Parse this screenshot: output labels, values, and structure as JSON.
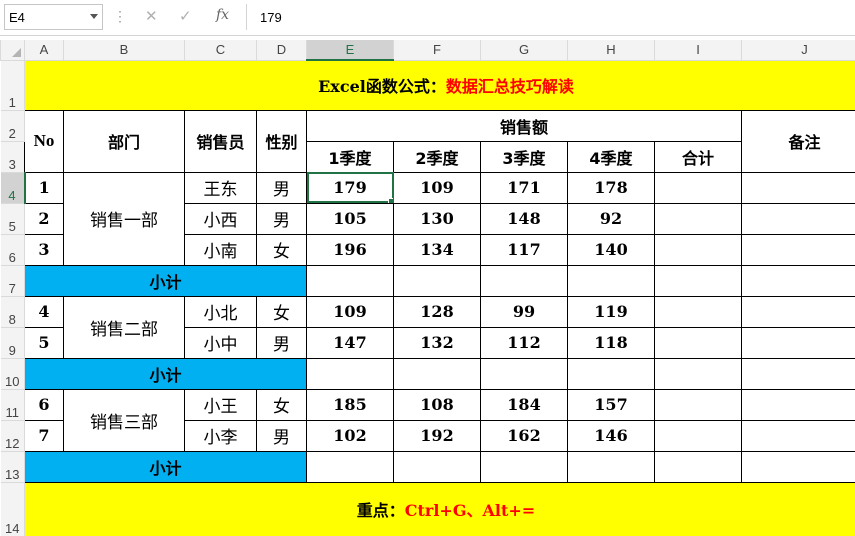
{
  "formula_bar": {
    "name_box": "E4",
    "formula": "179",
    "icons": [
      "more-dots-icon",
      "cancel-x-icon",
      "enter-check-icon",
      "function-fx-icon"
    ]
  },
  "columns": [
    "A",
    "B",
    "C",
    "D",
    "E",
    "F",
    "G",
    "H",
    "I",
    "J"
  ],
  "rows": [
    "1",
    "2",
    "3",
    "4",
    "5",
    "6",
    "7",
    "8",
    "9",
    "10",
    "11",
    "12",
    "13",
    "14"
  ],
  "selected": {
    "column": "E",
    "row": "4"
  },
  "sheet": {
    "title_black": "Excel函数公式：",
    "title_red": "数据汇总技巧解读",
    "header": {
      "no": "No",
      "dept": "部门",
      "salesperson": "销售员",
      "gender": "性别",
      "sales": "销售额",
      "q1": "1季度",
      "q2": "2季度",
      "q3": "3季度",
      "q4": "4季度",
      "total": "合计",
      "note": "备注"
    },
    "groups": [
      {
        "dept": "销售一部",
        "subtotal": "小计",
        "rows": [
          {
            "no": "1",
            "name": "王东",
            "gender": "男",
            "q1": "179",
            "q2": "109",
            "q3": "171",
            "q4": "178",
            "total": "",
            "note": ""
          },
          {
            "no": "2",
            "name": "小西",
            "gender": "男",
            "q1": "105",
            "q2": "130",
            "q3": "148",
            "q4": "92",
            "total": "",
            "note": ""
          },
          {
            "no": "3",
            "name": "小南",
            "gender": "女",
            "q1": "196",
            "q2": "134",
            "q3": "117",
            "q4": "140",
            "total": "",
            "note": ""
          }
        ]
      },
      {
        "dept": "销售二部",
        "subtotal": "小计",
        "rows": [
          {
            "no": "4",
            "name": "小北",
            "gender": "女",
            "q1": "109",
            "q2": "128",
            "q3": "99",
            "q4": "119",
            "total": "",
            "note": ""
          },
          {
            "no": "5",
            "name": "小中",
            "gender": "男",
            "q1": "147",
            "q2": "132",
            "q3": "112",
            "q4": "118",
            "total": "",
            "note": ""
          }
        ]
      },
      {
        "dept": "销售三部",
        "subtotal": "小计",
        "rows": [
          {
            "no": "6",
            "name": "小王",
            "gender": "女",
            "q1": "185",
            "q2": "108",
            "q3": "184",
            "q4": "157",
            "total": "",
            "note": ""
          },
          {
            "no": "7",
            "name": "小李",
            "gender": "男",
            "q1": "102",
            "q2": "192",
            "q3": "162",
            "q4": "146",
            "total": "",
            "note": ""
          }
        ]
      }
    ],
    "footer_black": "重点：",
    "footer_red": "Ctrl+G、Alt+="
  },
  "colors": {
    "title_fill": "#ffff00",
    "subtotal_fill": "#00b0f0",
    "highlight_text": "#ff0000",
    "selection": "#217346"
  }
}
